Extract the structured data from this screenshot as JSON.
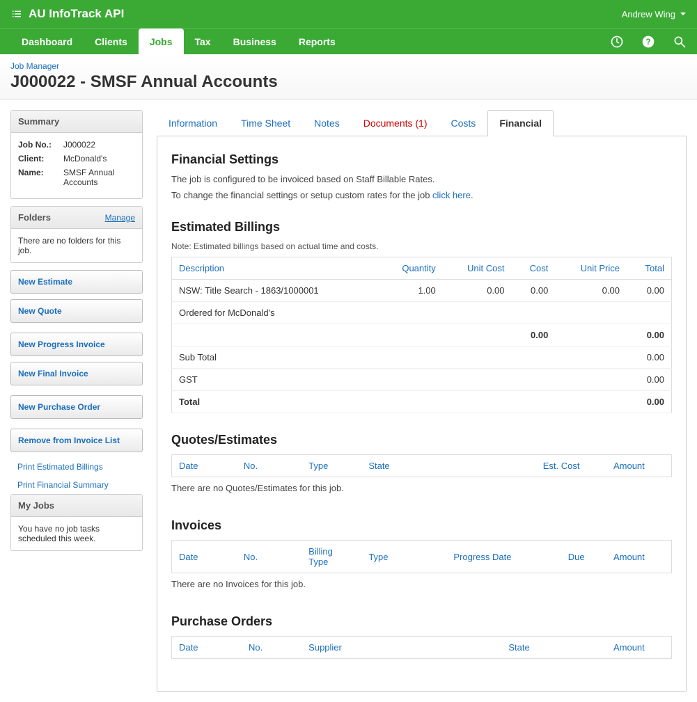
{
  "header": {
    "app_title": "AU InfoTrack API",
    "user_name": "Andrew Wing"
  },
  "nav": {
    "items": [
      "Dashboard",
      "Clients",
      "Jobs",
      "Tax",
      "Business",
      "Reports"
    ],
    "active_index": 2
  },
  "page": {
    "breadcrumb": "Job Manager",
    "title": "J000022 - SMSF Annual Accounts"
  },
  "sidebar": {
    "summary": {
      "title": "Summary",
      "rows": [
        {
          "label": "Job No.:",
          "value": "J000022"
        },
        {
          "label": "Client:",
          "value": "McDonald's"
        },
        {
          "label": "Name:",
          "value": "SMSF Annual Accounts"
        }
      ]
    },
    "folders": {
      "title": "Folders",
      "manage": "Manage",
      "empty": "There are no folders for this job."
    },
    "buttons": {
      "new_estimate": "New Estimate",
      "new_quote": "New Quote",
      "new_progress_invoice": "New Progress Invoice",
      "new_final_invoice": "New Final Invoice",
      "new_purchase_order": "New Purchase Order",
      "remove_from_invoice_list": "Remove from Invoice List"
    },
    "links": {
      "print_estimated_billings": "Print Estimated Billings",
      "print_financial_summary": "Print Financial Summary"
    },
    "my_jobs": {
      "title": "My Jobs",
      "text": "You have no job tasks scheduled this week."
    }
  },
  "tabs": {
    "information": "Information",
    "time_sheet": "Time Sheet",
    "notes": "Notes",
    "documents": "Documents (1)",
    "costs": "Costs",
    "financial": "Financial"
  },
  "financial": {
    "settings": {
      "heading": "Financial Settings",
      "line1": "The job is configured to be invoiced based on Staff Billable Rates.",
      "line2_prefix": "To change the financial settings or setup custom rates for the job ",
      "line2_link": "click here",
      "line2_suffix": "."
    },
    "estimated": {
      "heading": "Estimated Billings",
      "note": "Note: Estimated billings based on actual time and costs.",
      "columns": {
        "desc": "Description",
        "qty": "Quantity",
        "unit_cost": "Unit Cost",
        "cost": "Cost",
        "unit_price": "Unit Price",
        "total": "Total"
      },
      "rows": [
        {
          "desc": "NSW: Title Search - 1863/1000001",
          "qty": "1.00",
          "unit_cost": "0.00",
          "cost": "0.00",
          "unit_price": "0.00",
          "total": "0.00"
        },
        {
          "desc": "Ordered for McDonald's",
          "qty": "",
          "unit_cost": "",
          "cost": "",
          "unit_price": "",
          "total": ""
        }
      ],
      "summary_cost": "0.00",
      "summary_total": "0.00",
      "subtotal_label": "Sub Total",
      "subtotal_value": "0.00",
      "gst_label": "GST",
      "gst_value": "0.00",
      "total_label": "Total",
      "total_value": "0.00"
    },
    "quotes": {
      "heading": "Quotes/Estimates",
      "columns": {
        "date": "Date",
        "no": "No.",
        "type": "Type",
        "state": "State",
        "est_cost": "Est. Cost",
        "amount": "Amount"
      },
      "empty": "There are no Quotes/Estimates for this job."
    },
    "invoices": {
      "heading": "Invoices",
      "columns": {
        "date": "Date",
        "no": "No.",
        "billing_type": "Billing Type",
        "type": "Type",
        "progress_date": "Progress Date",
        "due": "Due",
        "amount": "Amount"
      },
      "empty": "There are no Invoices for this job."
    },
    "purchase_orders": {
      "heading": "Purchase Orders",
      "columns": {
        "date": "Date",
        "no": "No.",
        "supplier": "Supplier",
        "state": "State",
        "amount": "Amount"
      }
    }
  }
}
